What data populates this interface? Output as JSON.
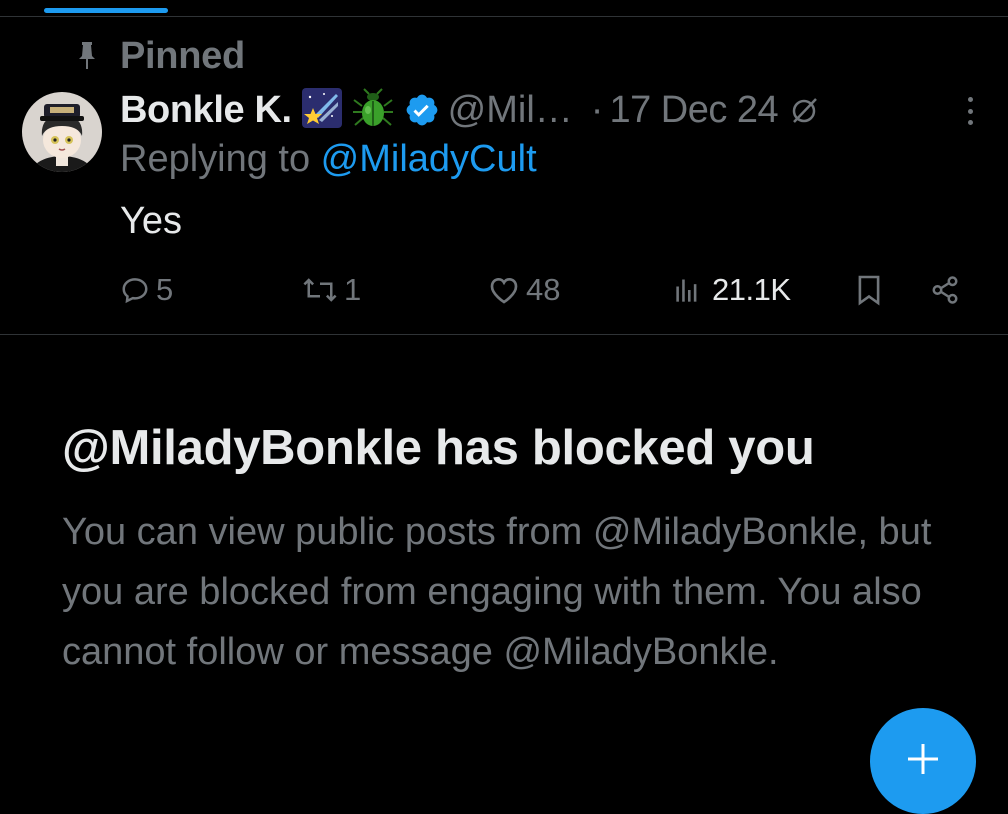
{
  "colors": {
    "background": "#000000",
    "accent": "#1d9bf0",
    "text": "#e7e9ea",
    "muted": "#71767b",
    "divider": "#2f3336"
  },
  "pinned": {
    "label": "Pinned",
    "icon": "pin-icon"
  },
  "post": {
    "display_name": "Bonkle K.",
    "emoji": [
      "comet-emoji",
      "beetle-emoji"
    ],
    "verified_icon": "verified-badge-icon",
    "handle": "@Mil…",
    "separator": "·",
    "date": "17 Dec 24",
    "replying_prefix": "Replying to ",
    "replying_to": "@MiladyCult",
    "text": "Yes",
    "actions": {
      "replies": "5",
      "reposts": "1",
      "likes": "48",
      "views": "21.1K"
    }
  },
  "blocked": {
    "title": "@MiladyBonkle has blocked you",
    "description": "You can view public posts from @MiladyBonkle, but you are blocked from engaging with them. You also cannot follow or message @MiladyBonkle."
  },
  "fab": {
    "icon": "plus-icon"
  }
}
